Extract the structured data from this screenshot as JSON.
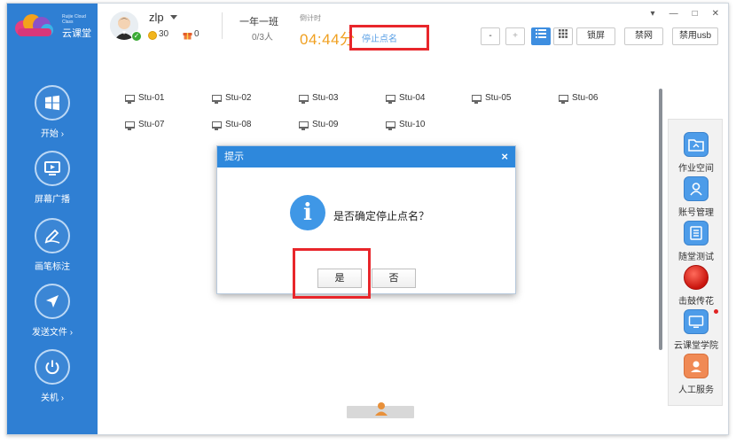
{
  "logo": {
    "small_text": "Ruijie Cloud Class",
    "name": "云课堂"
  },
  "sidebar": {
    "items": [
      {
        "label": "开始 ›",
        "icon": "windows-icon"
      },
      {
        "label": "屏幕广播",
        "icon": "screen-broadcast-icon"
      },
      {
        "label": "画笔标注",
        "icon": "pen-annotate-icon"
      },
      {
        "label": "发送文件 ›",
        "icon": "send-file-icon"
      },
      {
        "label": "关机 ›",
        "icon": "power-icon"
      }
    ]
  },
  "header": {
    "username": "zlp",
    "coins": "30",
    "gifts": "0",
    "class_name": "一年一班",
    "class_count": "0/3人",
    "timer_label": "倒计时",
    "timer_value": "04:44分",
    "stop_roll_call": "停止点名",
    "toolbar": {
      "minus": "-",
      "plus": "+",
      "lock_screen": "锁屏",
      "ban_network": "禁网",
      "ban_usb": "禁用usb"
    },
    "window_controls": [
      "▾",
      "—",
      "□",
      "✕"
    ]
  },
  "students": [
    "Stu-01",
    "Stu-02",
    "Stu-03",
    "Stu-04",
    "Stu-05",
    "Stu-06",
    "Stu-07",
    "Stu-08",
    "Stu-09",
    "Stu-10"
  ],
  "right_panel": {
    "items": [
      "作业空间",
      "账号管理",
      "随堂测试",
      "击鼓传花",
      "云课堂学院",
      "人工服务"
    ]
  },
  "dialog": {
    "title": "提示",
    "message": "是否确定停止点名？",
    "yes_label": "是",
    "no_label": "否",
    "icon": "info-icon"
  },
  "colors": {
    "sidebar": "#2f7fd3",
    "accent": "#2e88dc",
    "timer": "#f0a020",
    "highlight": "#e8262b"
  }
}
